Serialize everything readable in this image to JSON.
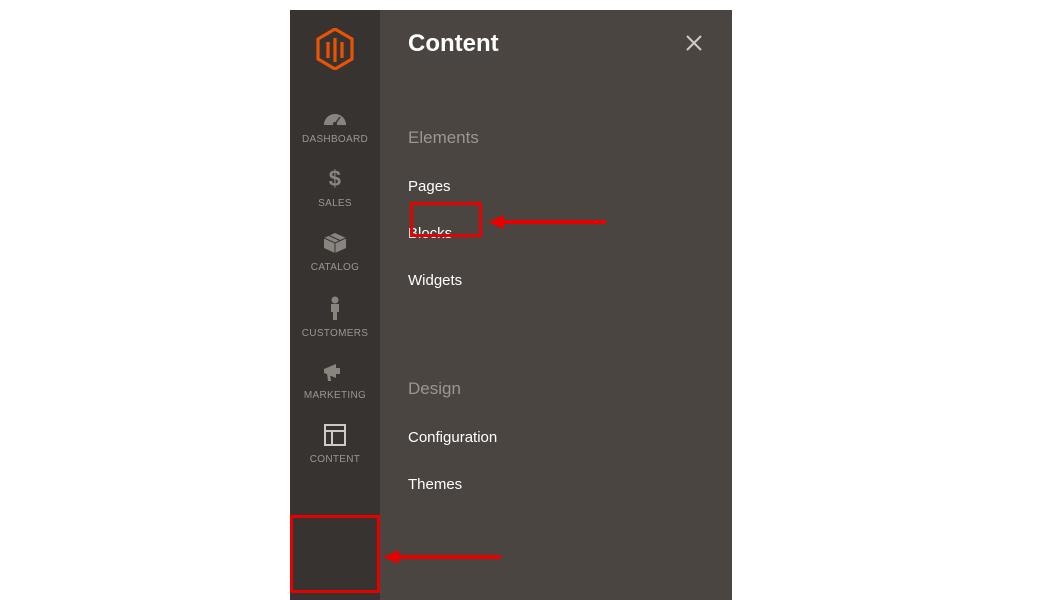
{
  "sidebar": {
    "items": [
      {
        "label": "DASHBOARD",
        "icon": "dashboard-icon"
      },
      {
        "label": "SALES",
        "icon": "dollar-icon"
      },
      {
        "label": "CATALOG",
        "icon": "box-icon"
      },
      {
        "label": "CUSTOMERS",
        "icon": "person-icon"
      },
      {
        "label": "MARKETING",
        "icon": "megaphone-icon"
      },
      {
        "label": "CONTENT",
        "icon": "layout-icon"
      }
    ]
  },
  "flyout": {
    "title": "Content",
    "sections": [
      {
        "header": "Elements",
        "items": [
          "Pages",
          "Blocks",
          "Widgets"
        ]
      },
      {
        "header": "Design",
        "items": [
          "Configuration",
          "Themes"
        ]
      }
    ]
  },
  "colors": {
    "accent": "#eb5202",
    "highlight": "#e60000",
    "sidebar_bg": "#373330",
    "flyout_bg": "#4a4540"
  }
}
